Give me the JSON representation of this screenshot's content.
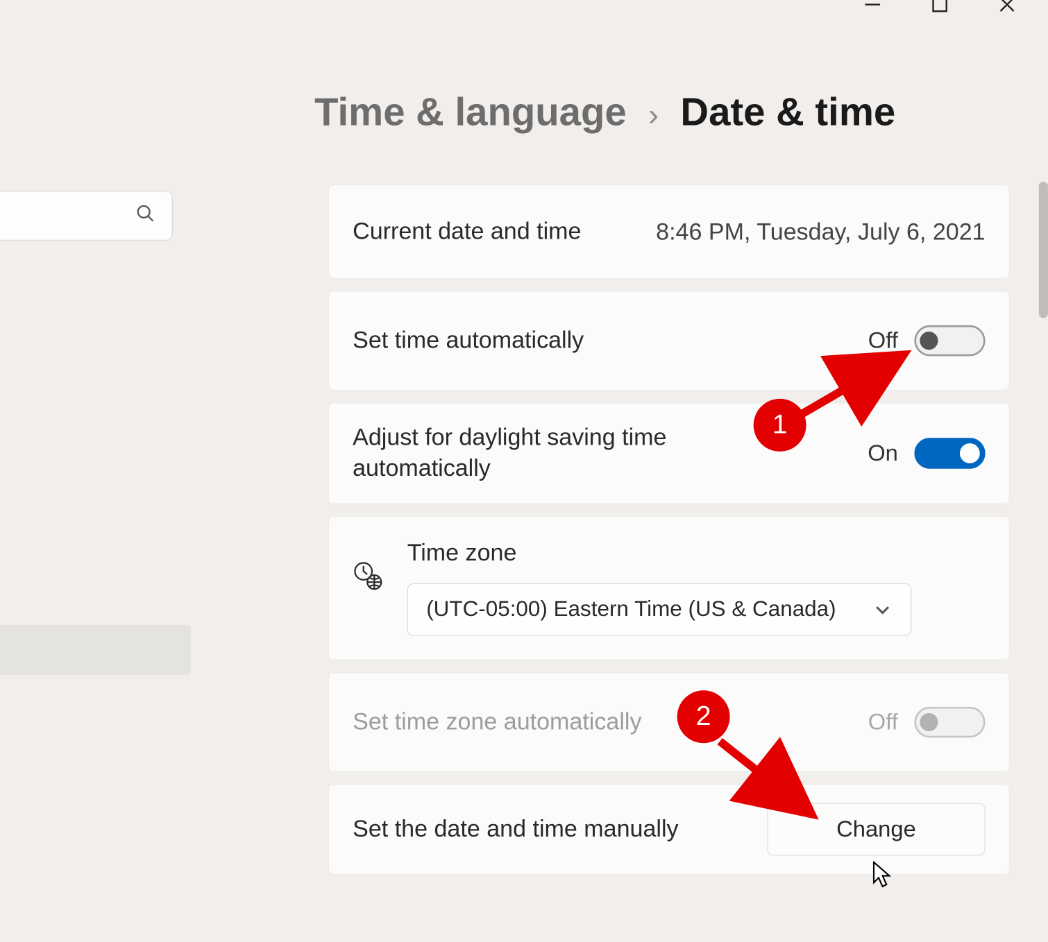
{
  "breadcrumb": {
    "parent": "Time & language",
    "separator": "›",
    "current": "Date & time"
  },
  "search": {
    "placeholder": ""
  },
  "cards": {
    "current": {
      "label": "Current date and time",
      "value": "8:46 PM, Tuesday, July 6, 2021"
    },
    "auto_time": {
      "label": "Set time automatically",
      "state_text": "Off"
    },
    "dst": {
      "label": "Adjust for daylight saving time automatically",
      "state_text": "On"
    },
    "timezone": {
      "label": "Time zone",
      "selected": "(UTC-05:00) Eastern Time (US & Canada)"
    },
    "auto_tz": {
      "label": "Set time zone automatically",
      "state_text": "Off"
    },
    "manual": {
      "label": "Set the date and time manually",
      "button": "Change"
    }
  },
  "annotations": {
    "one": "1",
    "two": "2"
  }
}
